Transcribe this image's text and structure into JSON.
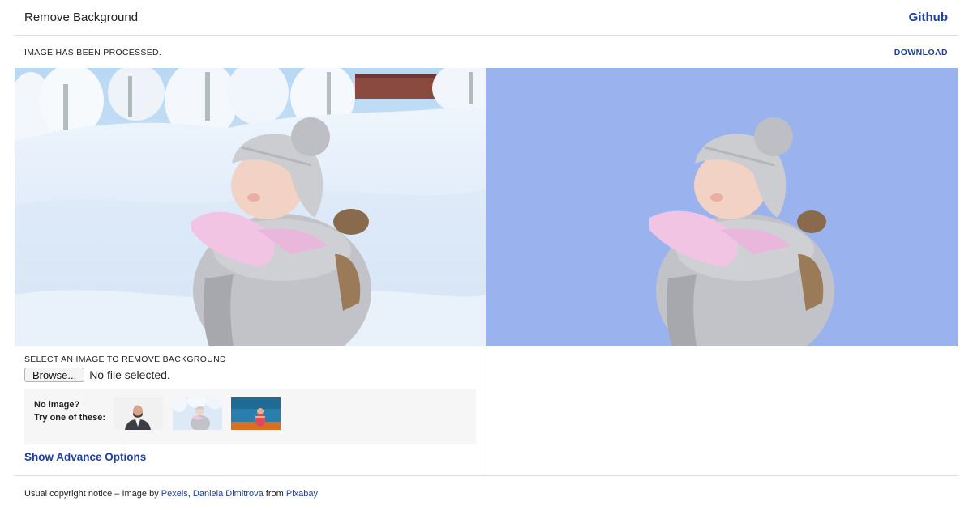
{
  "header": {
    "title": "Remove Background",
    "github_label": "Github"
  },
  "status": {
    "message": "IMAGE HAS BEEN PROCESSED.",
    "download_label": "DOWNLOAD"
  },
  "result": {
    "background_color": "#9ab2ee"
  },
  "upload": {
    "label": "SELECT AN IMAGE TO REMOVE BACKGROUND",
    "browse_label": "Browse...",
    "file_status": "No file selected."
  },
  "samples": {
    "line1": "No image?",
    "line2": "Try one of these:"
  },
  "advance_options_label": "Show Advance Options",
  "footer": {
    "prefix": "Usual copyright notice – Image by ",
    "link1": "Pexels",
    "sep1": ", ",
    "link2": "Daniela Dimitrova",
    "sep2": " from ",
    "link3": "Pixabay"
  },
  "colors": {
    "accent": "#1d3f9e",
    "result_bg": "#9ab2ee"
  }
}
